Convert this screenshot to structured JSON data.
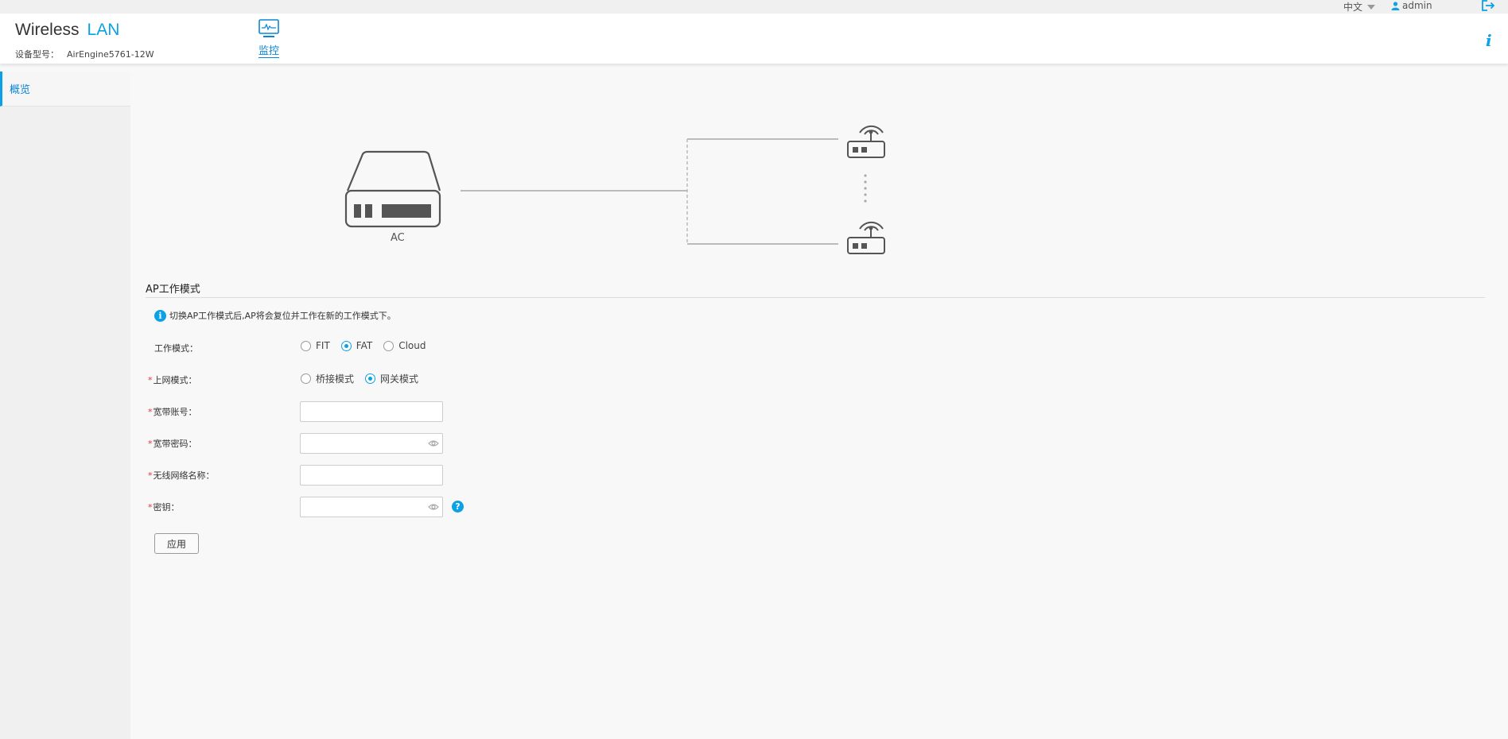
{
  "topbar": {
    "language": "中文",
    "user": "admin"
  },
  "header": {
    "brand_main": "Wireless",
    "brand_accent": "LAN",
    "model_label": "设备型号：",
    "model_value": "AirEngine5761-12W",
    "nav_monitor": "监控"
  },
  "sidebar": {
    "items": [
      {
        "label": "概览"
      }
    ]
  },
  "topology": {
    "ac_label": "AC"
  },
  "section": {
    "title": "AP工作模式",
    "notice": "切换AP工作模式后,AP将会复位并工作在新的工作模式下。"
  },
  "form": {
    "work_mode": {
      "label": "工作模式：",
      "options": [
        "FIT",
        "FAT",
        "Cloud"
      ],
      "selected": "FAT"
    },
    "uplink_mode": {
      "label": "上网模式：",
      "options": [
        "桥接模式",
        "网关模式"
      ],
      "selected": "网关模式"
    },
    "broadband_account": {
      "label": "宽带账号：",
      "value": ""
    },
    "broadband_password": {
      "label": "宽带密码：",
      "value": ""
    },
    "ssid": {
      "label": "无线网络名称：",
      "value": ""
    },
    "key": {
      "label": "密钥：",
      "value": ""
    },
    "required_mark": "*",
    "apply_label": "应用"
  },
  "colors": {
    "accent": "#0aa1e6",
    "required": "#e33333"
  },
  "icons": {
    "monitor": "monitor-icon",
    "user": "user-icon",
    "logout": "logout-icon",
    "info": "info-icon",
    "eye": "eye-icon",
    "help": "help-icon"
  }
}
